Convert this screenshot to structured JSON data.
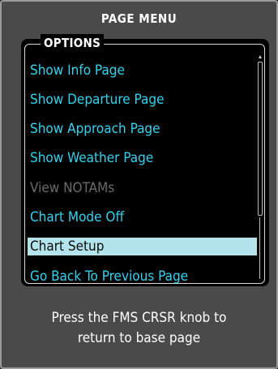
{
  "header": {
    "title": "PAGE MENU"
  },
  "options_group": {
    "label": "OPTIONS"
  },
  "menu": {
    "items": [
      {
        "label": "Show Info Page",
        "state": "enabled"
      },
      {
        "label": "Show Departure Page",
        "state": "enabled"
      },
      {
        "label": "Show Approach Page",
        "state": "enabled"
      },
      {
        "label": "Show Weather Page",
        "state": "enabled"
      },
      {
        "label": "View NOTAMs",
        "state": "disabled"
      },
      {
        "label": "Chart Mode Off",
        "state": "enabled"
      },
      {
        "label": "Chart Setup",
        "state": "selected"
      },
      {
        "label": "Go Back To Previous Page",
        "state": "enabled"
      }
    ]
  },
  "footer": {
    "line1": "Press the FMS CRSR knob to",
    "line2": "return to base page"
  },
  "colors": {
    "frame": "#4a4a4a",
    "menu_background": "#000000",
    "item_text": "#34d1ee",
    "item_disabled": "#6b6b6b",
    "selection_highlight": "#b3e3eb",
    "title_text": "#ffffff"
  }
}
